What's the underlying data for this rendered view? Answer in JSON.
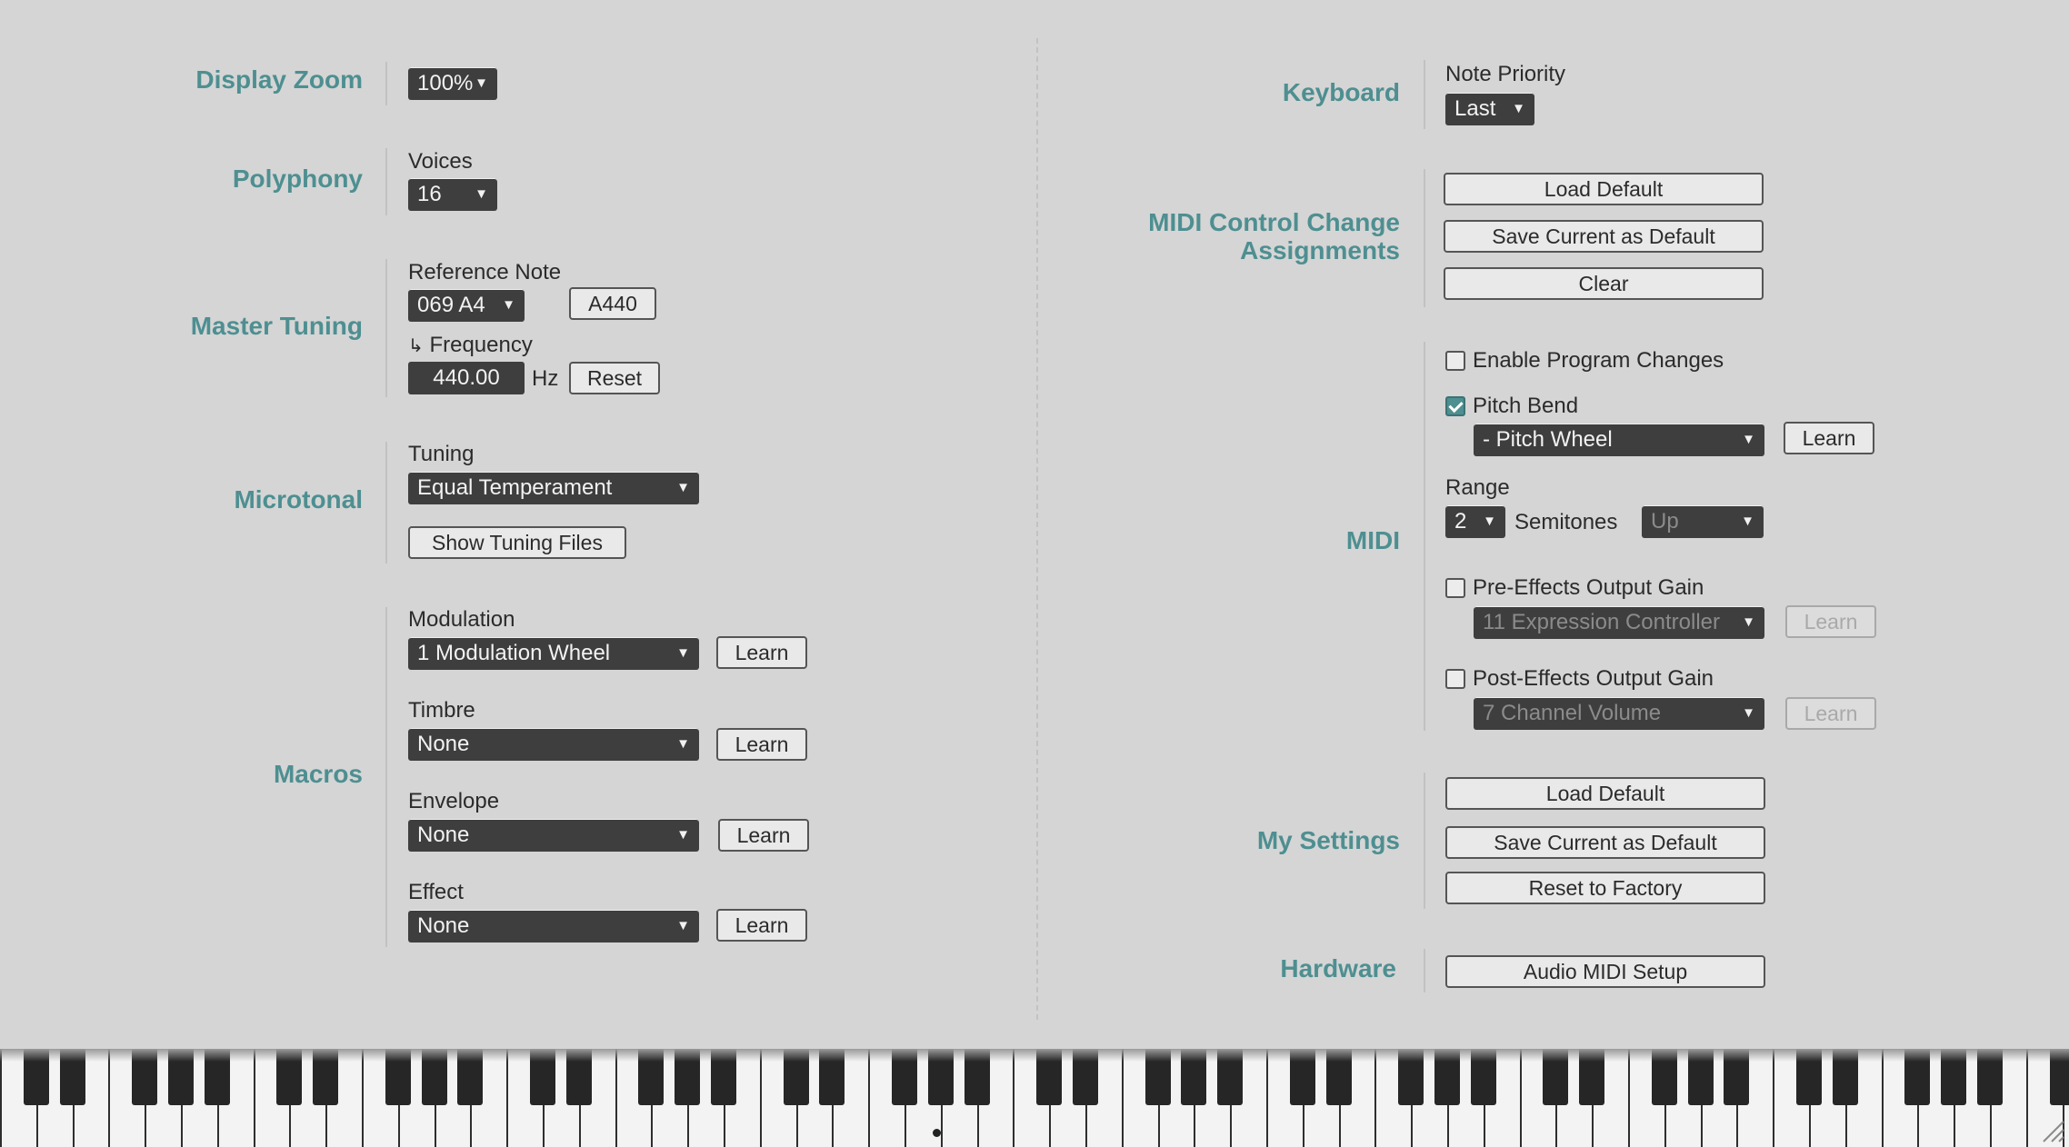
{
  "left": {
    "display_zoom": {
      "title": "Display Zoom",
      "value": "100%"
    },
    "polyphony": {
      "title": "Polyphony",
      "voices_label": "Voices",
      "voices_value": "16"
    },
    "master_tuning": {
      "title": "Master Tuning",
      "reference_note_label": "Reference Note",
      "reference_note_value": "069 A4",
      "a440_label": "A440",
      "frequency_label": "Frequency",
      "frequency_value": "440.00",
      "frequency_unit": "Hz",
      "reset_label": "Reset"
    },
    "microtonal": {
      "title": "Microtonal",
      "tuning_label": "Tuning",
      "tuning_value": "Equal Temperament",
      "show_files_label": "Show Tuning Files"
    },
    "macros": {
      "title": "Macros",
      "items": [
        {
          "label": "Modulation",
          "value": "1 Modulation Wheel",
          "learn": "Learn"
        },
        {
          "label": "Timbre",
          "value": "None",
          "learn": "Learn"
        },
        {
          "label": "Envelope",
          "value": "None",
          "learn": "Learn"
        },
        {
          "label": "Effect",
          "value": "None",
          "learn": "Learn"
        }
      ]
    }
  },
  "right": {
    "keyboard": {
      "title": "Keyboard",
      "note_priority_label": "Note Priority",
      "note_priority_value": "Last"
    },
    "midi_cc": {
      "title_line1": "MIDI Control Change",
      "title_line2": "Assignments",
      "load_default": "Load Default",
      "save_default": "Save Current as Default",
      "clear": "Clear"
    },
    "midi": {
      "title": "MIDI",
      "enable_program_changes": {
        "label": "Enable Program Changes",
        "checked": false
      },
      "pitch_bend": {
        "label": "Pitch Bend",
        "checked": true,
        "source": "- Pitch Wheel",
        "learn": "Learn"
      },
      "range_label": "Range",
      "range_value": "2",
      "semitones_label": "Semitones",
      "direction_value": "Up",
      "pre_gain": {
        "label": "Pre-Effects Output Gain",
        "checked": false,
        "source": "11 Expression Controller",
        "learn": "Learn"
      },
      "post_gain": {
        "label": "Post-Effects Output Gain",
        "checked": false,
        "source": "7 Channel Volume",
        "learn": "Learn"
      }
    },
    "my_settings": {
      "title": "My Settings",
      "load_default": "Load Default",
      "save_default": "Save Current as Default",
      "reset_factory": "Reset to Factory"
    },
    "hardware": {
      "title": "Hardware",
      "audio_midi_setup": "Audio MIDI Setup"
    }
  },
  "colors": {
    "accent": "#4e8f91",
    "background": "#d5d5d5",
    "control_dark": "#3e3e3e"
  }
}
